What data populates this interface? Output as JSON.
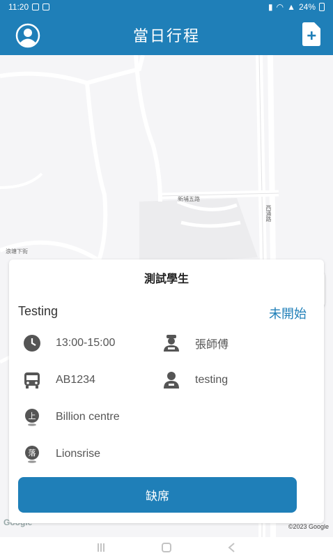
{
  "status_bar": {
    "time": "11:20",
    "battery": "24%"
  },
  "header": {
    "title": "當日行程",
    "profile_icon": "profile-icon",
    "add_doc_icon": "document-add-icon"
  },
  "map": {
    "labels": {
      "road_1": "新埔五路",
      "road_2": "浪塘下街",
      "road_3": "西涌路"
    },
    "copyright": "©2023 Google",
    "logo": "Google"
  },
  "card": {
    "title": "測試學生",
    "trip_name": "Testing",
    "trip_status": "未開始",
    "time": "13:00-15:00",
    "driver": "張師傅",
    "bus_no": "AB1234",
    "attendant": "testing",
    "pickup": "Billion centre",
    "dropoff": "Lionsrise",
    "absent_label": "缺席"
  },
  "colors": {
    "primary": "#1f7fb8",
    "icon_gray": "#555555"
  }
}
